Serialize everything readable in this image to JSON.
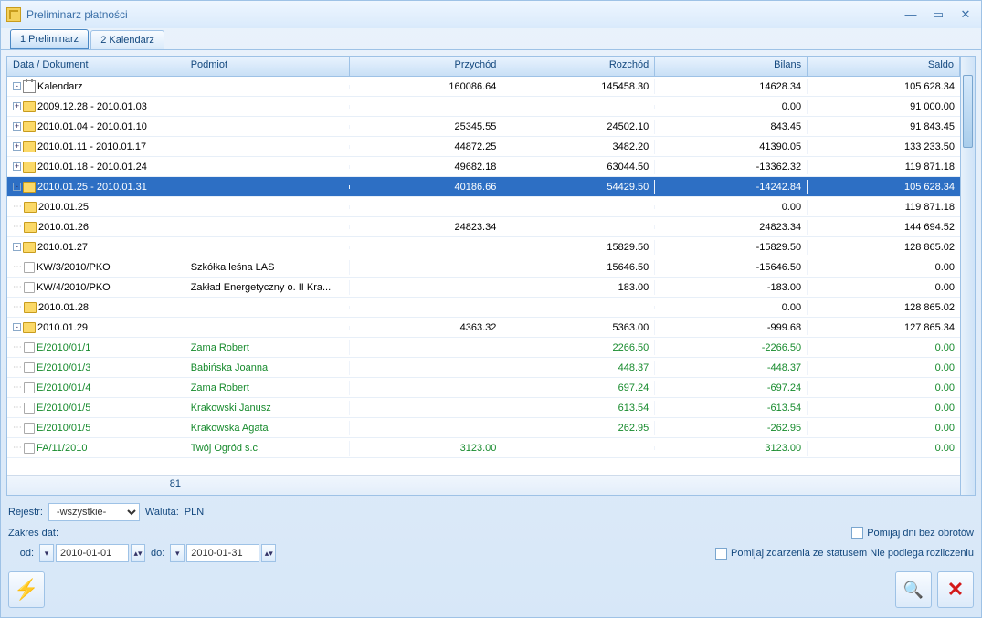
{
  "window": {
    "title": "Preliminarz płatności"
  },
  "tabs": [
    {
      "label": "1 Preliminarz",
      "active": true
    },
    {
      "label": "2 Kalendarz",
      "active": false
    }
  ],
  "columns": {
    "tree": "Data / Dokument",
    "podmiot": "Podmiot",
    "przychod": "Przychód",
    "rozchod": "Rozchód",
    "bilans": "Bilans",
    "saldo": "Saldo"
  },
  "rows": [
    {
      "indent": 0,
      "exp": "-",
      "icon": "cal",
      "label": "Kalendarz",
      "pod": "",
      "p": "160086.64",
      "r": "145458.30",
      "b": "14628.34",
      "s": "105 628.34",
      "sel": false
    },
    {
      "indent": 1,
      "exp": "+",
      "icon": "folder",
      "label": "2009.12.28 - 2010.01.03",
      "pod": "",
      "p": "",
      "r": "",
      "b": "0.00",
      "s": "91 000.00",
      "sel": false
    },
    {
      "indent": 1,
      "exp": "+",
      "icon": "folder",
      "label": "2010.01.04 - 2010.01.10",
      "pod": "",
      "p": "25345.55",
      "r": "24502.10",
      "b": "843.45",
      "s": "91 843.45",
      "sel": false
    },
    {
      "indent": 1,
      "exp": "+",
      "icon": "folder",
      "label": "2010.01.11 - 2010.01.17",
      "pod": "",
      "p": "44872.25",
      "r": "3482.20",
      "b": "41390.05",
      "s": "133 233.50",
      "sel": false
    },
    {
      "indent": 1,
      "exp": "+",
      "icon": "folder",
      "label": "2010.01.18 - 2010.01.24",
      "pod": "",
      "p": "49682.18",
      "r": "63044.50",
      "b": "-13362.32",
      "s": "119 871.18",
      "sel": false
    },
    {
      "indent": 1,
      "exp": "-",
      "icon": "folder",
      "label": "2010.01.25 - 2010.01.31",
      "pod": "",
      "p": "40186.66",
      "r": "54429.50",
      "b": "-14242.84",
      "s": "105 628.34",
      "sel": true
    },
    {
      "indent": 2,
      "exp": "",
      "icon": "folder",
      "label": "2010.01.25",
      "pod": "",
      "p": "",
      "r": "",
      "b": "0.00",
      "s": "119 871.18",
      "sel": false
    },
    {
      "indent": 2,
      "exp": "",
      "icon": "folder",
      "label": "2010.01.26",
      "pod": "",
      "p": "24823.34",
      "r": "",
      "b": "24823.34",
      "s": "144 694.52",
      "sel": false
    },
    {
      "indent": 2,
      "exp": "-",
      "icon": "folder",
      "label": "2010.01.27",
      "pod": "",
      "p": "",
      "r": "15829.50",
      "b": "-15829.50",
      "s": "128 865.02",
      "sel": false
    },
    {
      "indent": 3,
      "exp": "",
      "icon": "doc",
      "label": "KW/3/2010/PKO",
      "pod": "Szkółka leśna LAS",
      "p": "",
      "r": "15646.50",
      "b": "-15646.50",
      "s": "0.00",
      "sel": false
    },
    {
      "indent": 3,
      "exp": "",
      "icon": "doc",
      "label": "KW/4/2010/PKO",
      "pod": "Zakład Energetyczny o. II Kra...",
      "p": "",
      "r": "183.00",
      "b": "-183.00",
      "s": "0.00",
      "sel": false
    },
    {
      "indent": 2,
      "exp": "",
      "icon": "folder",
      "label": "2010.01.28",
      "pod": "",
      "p": "",
      "r": "",
      "b": "0.00",
      "s": "128 865.02",
      "sel": false
    },
    {
      "indent": 2,
      "exp": "-",
      "icon": "folder",
      "label": "2010.01.29",
      "pod": "",
      "p": "4363.32",
      "r": "5363.00",
      "b": "-999.68",
      "s": "127 865.34",
      "sel": false
    },
    {
      "indent": 3,
      "exp": "",
      "icon": "doc",
      "label": "E/2010/01/1",
      "pod": "Zama Robert",
      "p": "",
      "r": "2266.50",
      "b": "-2266.50",
      "s": "0.00",
      "green": true
    },
    {
      "indent": 3,
      "exp": "",
      "icon": "doc",
      "label": "E/2010/01/3",
      "pod": "Babińska Joanna",
      "p": "",
      "r": "448.37",
      "b": "-448.37",
      "s": "0.00",
      "green": true
    },
    {
      "indent": 3,
      "exp": "",
      "icon": "doc",
      "label": "E/2010/01/4",
      "pod": "Zama Robert",
      "p": "",
      "r": "697.24",
      "b": "-697.24",
      "s": "0.00",
      "green": true
    },
    {
      "indent": 3,
      "exp": "",
      "icon": "doc",
      "label": "E/2010/01/5",
      "pod": "Krakowski Janusz",
      "p": "",
      "r": "613.54",
      "b": "-613.54",
      "s": "0.00",
      "green": true
    },
    {
      "indent": 3,
      "exp": "",
      "icon": "doc",
      "label": "E/2010/01/5",
      "pod": "Krakowska Agata",
      "p": "",
      "r": "262.95",
      "b": "-262.95",
      "s": "0.00",
      "green": true
    },
    {
      "indent": 3,
      "exp": "",
      "icon": "doc",
      "label": "FA/11/2010",
      "pod": "Twój Ogród s.c.",
      "p": "3123.00",
      "r": "",
      "b": "3123.00",
      "s": "0.00",
      "green": true
    }
  ],
  "footer_count": "81",
  "filters": {
    "rejestr_label": "Rejestr:",
    "rejestr_value": "-wszystkie-",
    "waluta_label": "Waluta:",
    "waluta_value": "PLN",
    "zakres_label": "Zakres dat:",
    "od_label": "od:",
    "od_value": "2010-01-01",
    "do_label": "do:",
    "do_value": "2010-01-31",
    "chk1": "Pomijaj dni bez obrotów",
    "chk2": "Pomijaj zdarzenia ze statusem Nie podlega rozliczeniu"
  }
}
